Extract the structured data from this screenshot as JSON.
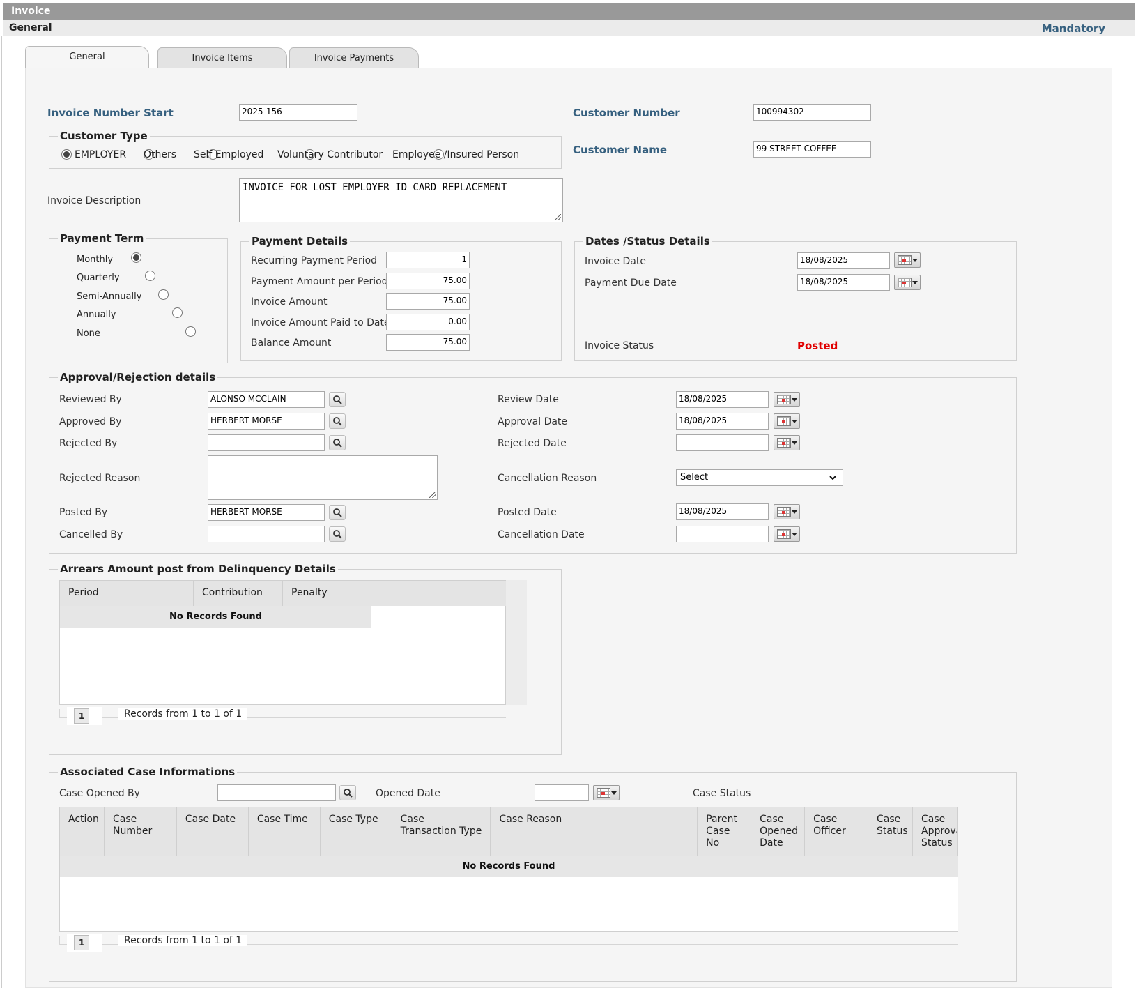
{
  "window": {
    "title": "Invoice",
    "section": "General",
    "mandatory_link": "Mandatory"
  },
  "tabs": [
    {
      "label": "General",
      "active": true
    },
    {
      "label": "Invoice Items",
      "active": false
    },
    {
      "label": "Invoice Payments",
      "active": false
    }
  ],
  "header_fields": {
    "invoice_number_label": "Invoice Number Start",
    "invoice_number_value": "2025-156",
    "customer_number_label": "Customer Number",
    "customer_number_value": "100994302",
    "customer_name_label": "Customer Name",
    "customer_name_value": "99 STREET COFFEE",
    "invoice_description_label": "Invoice Description",
    "invoice_description_value": "INVOICE FOR LOST EMPLOYER ID CARD REPLACEMENT"
  },
  "customer_type": {
    "legend": "Customer Type",
    "options": [
      "EMPLOYER",
      "Others",
      "Self Employed",
      "Voluntary Contributor",
      "Employee /Insured Person"
    ],
    "selected": "EMPLOYER"
  },
  "payment_term": {
    "legend": "Payment Term",
    "options": [
      "Monthly",
      "Quarterly",
      "Semi-Annually",
      "Annually",
      "None"
    ],
    "selected": "Monthly"
  },
  "payment_details": {
    "legend": "Payment Details",
    "rows": [
      {
        "label": "Recurring Payment Period",
        "value": "1"
      },
      {
        "label": "Payment Amount per Period",
        "value": "75.00"
      },
      {
        "label": "Invoice Amount",
        "value": "75.00"
      },
      {
        "label": "Invoice Amount Paid to Date",
        "value": "0.00"
      },
      {
        "label": "Balance Amount",
        "value": "75.00"
      }
    ]
  },
  "dates_status": {
    "legend": "Dates /Status Details",
    "invoice_date_label": "Invoice Date",
    "invoice_date_value": "18/08/2025",
    "payment_due_label": "Payment Due Date",
    "payment_due_value": "18/08/2025",
    "status_label": "Invoice Status",
    "status_value": "Posted",
    "status_color": "#e00000"
  },
  "approval": {
    "legend": "Approval/Rejection details",
    "reviewed_by_label": "Reviewed By",
    "reviewed_by_value": "ALONSO MCCLAIN",
    "approved_by_label": "Approved By",
    "approved_by_value": "HERBERT MORSE",
    "rejected_by_label": "Rejected By",
    "rejected_by_value": "",
    "rejected_reason_label": "Rejected Reason",
    "rejected_reason_value": "",
    "posted_by_label": "Posted By",
    "posted_by_value": "HERBERT MORSE",
    "cancelled_by_label": "Cancelled By",
    "cancelled_by_value": "",
    "review_date_label": "Review Date",
    "review_date_value": "18/08/2025",
    "approval_date_label": "Approval Date",
    "approval_date_value": "18/08/2025",
    "rejected_date_label": "Rejected Date",
    "rejected_date_value": "",
    "cancellation_reason_label": "Cancellation Reason",
    "cancellation_reason_value": "Select",
    "posted_date_label": "Posted Date",
    "posted_date_value": "18/08/2025",
    "cancellation_date_label": "Cancellation Date",
    "cancellation_date_value": ""
  },
  "arrears": {
    "legend": "Arrears Amount post from Delinquency Details",
    "columns": [
      "Period",
      "Contribution",
      "Penalty"
    ],
    "empty_text": "No Records Found",
    "page": "1",
    "records_text": "Records from 1 to 1 of 1"
  },
  "cases": {
    "legend": "Associated Case Informations",
    "case_opened_by_label": "Case Opened By",
    "case_opened_by_value": "",
    "opened_date_label": "Opened Date",
    "opened_date_value": "",
    "case_status_label": "Case Status",
    "columns": [
      "Action",
      "Case Number",
      "Case Date",
      "Case Time",
      "Case Type",
      "Case Transaction Type",
      "Case Reason",
      "Parent Case No",
      "Case Opened Date",
      "Case Officer",
      "Case Status",
      "Case Approval Status"
    ],
    "empty_text": "No Records Found",
    "page": "1",
    "records_text": "Records from 1 to 1 of 1"
  }
}
